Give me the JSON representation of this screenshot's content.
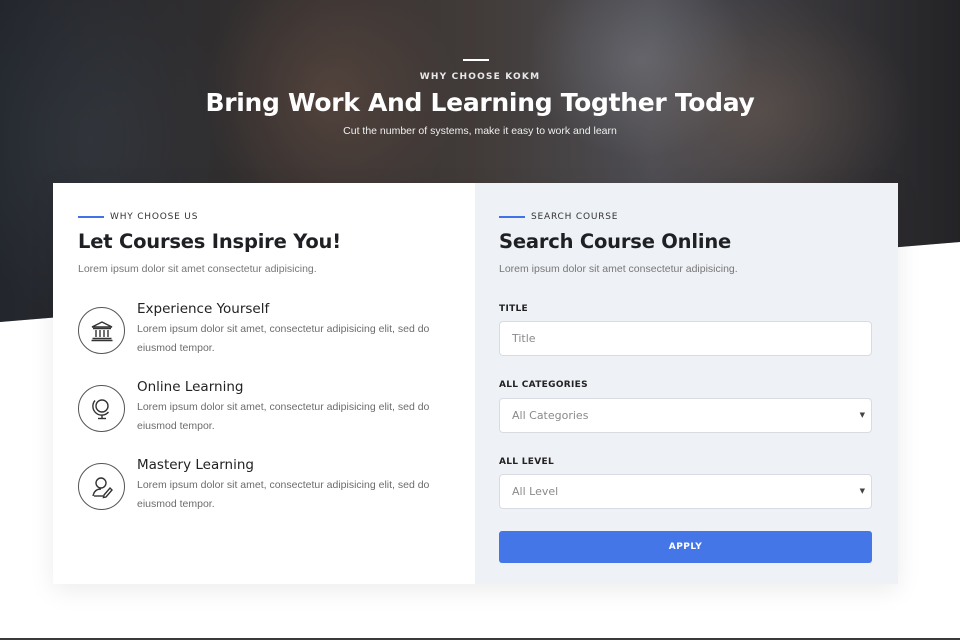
{
  "hero": {
    "eyebrow": "WHY CHOOSE KOKM",
    "title": "Bring Work And Learning Togther Today",
    "subtitle": "Cut the number of systems, make it easy to work and learn"
  },
  "why": {
    "eyebrow": "WHY CHOOSE US",
    "title": "Let Courses Inspire You!",
    "description": "Lorem ipsum dolor sit amet consectetur adipisicing.",
    "features": [
      {
        "icon": "bank-icon",
        "title": "Experience Yourself",
        "description": "Lorem ipsum dolor sit amet, consectetur adipisicing elit, sed do eiusmod tempor."
      },
      {
        "icon": "globe-icon",
        "title": "Online Learning",
        "description": "Lorem ipsum dolor sit amet, consectetur adipisicing elit, sed do eiusmod tempor."
      },
      {
        "icon": "user-edit-icon",
        "title": "Mastery Learning",
        "description": "Lorem ipsum dolor sit amet, consectetur adipisicing elit, sed do eiusmod tempor."
      }
    ]
  },
  "search": {
    "eyebrow": "SEARCH COURSE",
    "title": "Search Course Online",
    "description": "Lorem ipsum dolor sit amet consectetur adipisicing.",
    "title_label": "TITLE",
    "title_placeholder": "Title",
    "title_value": "",
    "categories_label": "ALL CATEGORIES",
    "categories_selected": "All Categories",
    "level_label": "ALL LEVEL",
    "level_selected": "All Level",
    "apply_label": "APPLY"
  },
  "colors": {
    "accent": "#4476e8",
    "panel_bg": "#eef1f5"
  }
}
